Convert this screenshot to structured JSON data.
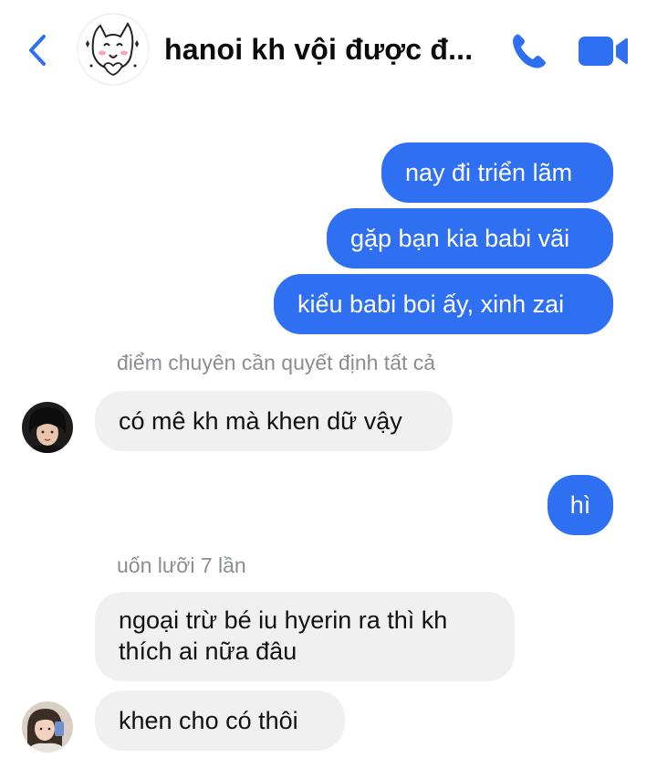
{
  "header": {
    "title": "hanoi kh vội được đ...",
    "back_icon": "chevron-left-icon",
    "call_icon": "phone-icon",
    "video_icon": "video-camera-icon",
    "accent_color": "#2f6ff2"
  },
  "messages": [
    {
      "direction": "outgoing",
      "text": "nay đi triển lãm"
    },
    {
      "direction": "outgoing",
      "text": "gặp bạn kia babi vãi"
    },
    {
      "direction": "outgoing",
      "text": "kiểu babi boi ấy, xinh zai"
    },
    {
      "direction": "incoming",
      "reply_label": "điểm chuyên cần quyết định tất cả",
      "text": "có mê kh mà khen dữ vậy"
    },
    {
      "direction": "outgoing",
      "text": "hì"
    },
    {
      "direction": "incoming",
      "reply_label": "uốn lưỡi 7 lần",
      "text_line1": "ngoại trừ bé iu hyerin ra thì kh",
      "text_line2": "thích ai nữa đâu"
    },
    {
      "direction": "incoming",
      "text": "khen cho có thôi"
    }
  ],
  "colors": {
    "outgoing_bubble": "#2f6ff2",
    "incoming_bubble": "#f0f0f1",
    "reply_label": "#8a8d91"
  }
}
